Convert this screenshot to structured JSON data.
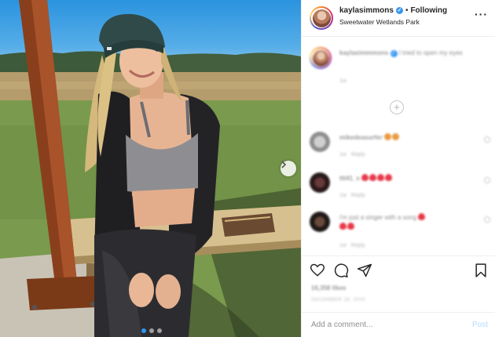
{
  "post": {
    "username": "kaylasimmons",
    "follow_separator": "•",
    "follow_label": "Following",
    "location": "Sweetwater Wetlands Park",
    "more_icon": "more-horizontal-icon",
    "photo_count": 3,
    "active_photo": 1
  },
  "caption": {
    "username": "kaylasimmmons",
    "text": "I tried to open my eyes",
    "age": "1w"
  },
  "comments": [
    {
      "username": "mikedeasurfer",
      "text": "",
      "emoji": [
        "orange",
        "orange"
      ],
      "age": "1w",
      "reply_label": "Reply"
    },
    {
      "username": "ttt41_s",
      "text": "",
      "emoji": [
        "red",
        "red",
        "red",
        "red"
      ],
      "age": "1w",
      "reply_label": "Reply"
    },
    {
      "username": "",
      "text": "i'm just a singer with a song",
      "emoji": [
        "red",
        "red",
        "red"
      ],
      "age": "1w",
      "reply_label": "Reply"
    }
  ],
  "actions": {
    "likes": "16,358 likes",
    "date": "DECEMBER 18, 2020"
  },
  "add_comment": {
    "placeholder": "Add a comment...",
    "post_label": "Post"
  },
  "colors": {
    "verified": "#3897f0",
    "post_button": "#b3dbff",
    "active_dot": "#2d96f0"
  }
}
